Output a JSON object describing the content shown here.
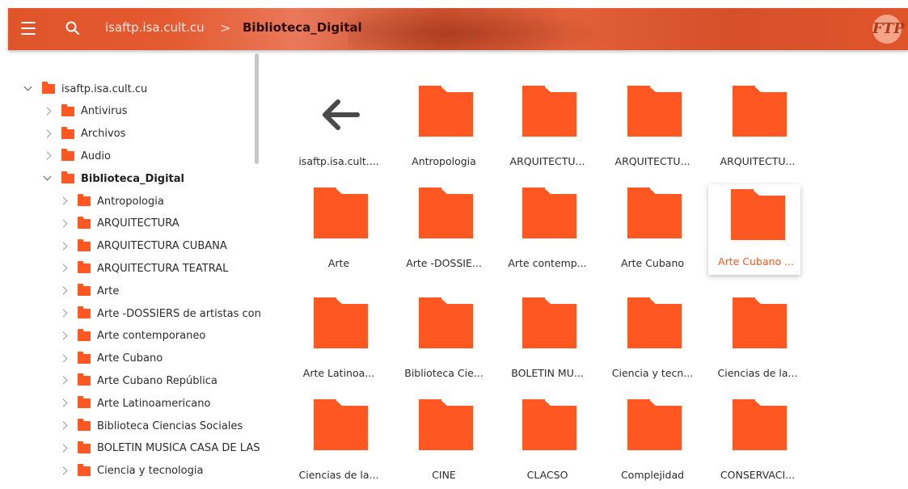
{
  "header": {
    "breadcrumb_root": "isaftp.isa.cult.cu",
    "breadcrumb_sep": ">",
    "breadcrumb_current": "Biblioteca_Digital",
    "logo_text": "FTP",
    "menu_icon": "hamburger-menu-icon",
    "search_icon": "search-icon",
    "accent_color": "#e0542a"
  },
  "tree": [
    {
      "label": "isaftp.isa.cult.cu",
      "expanded": true
    },
    {
      "label": "Antivirus"
    },
    {
      "label": "Archivos"
    },
    {
      "label": "Audio"
    },
    {
      "label": "Biblioteca_Digital",
      "expanded": true
    },
    {
      "label": "Antropologia"
    },
    {
      "label": "ARQUITECTURA"
    },
    {
      "label": "ARQUITECTURA CUBANA"
    },
    {
      "label": "ARQUITECTURA TEATRAL"
    },
    {
      "label": "Arte"
    },
    {
      "label": "Arte -DOSSIERS de artistas contei"
    },
    {
      "label": "Arte contemporaneo"
    },
    {
      "label": "Arte Cubano"
    },
    {
      "label": "Arte Cubano República"
    },
    {
      "label": "Arte Latinoamericano"
    },
    {
      "label": "Biblioteca Ciencias Sociales"
    },
    {
      "label": "BOLETIN MUSICA CASA DE LAS A"
    },
    {
      "label": "Ciencia y tecnologia"
    }
  ],
  "grid": [
    {
      "label": "isaftp.isa.cult....",
      "type": "back"
    },
    {
      "label": "Antropologia"
    },
    {
      "label": "ARQUITECTU..."
    },
    {
      "label": "ARQUITECTU..."
    },
    {
      "label": "ARQUITECTU..."
    },
    {
      "label": "Arte"
    },
    {
      "label": "Arte -DOSSIE..."
    },
    {
      "label": "Arte contemp..."
    },
    {
      "label": "Arte Cubano"
    },
    {
      "label": "Arte Cubano ...",
      "selected": true
    },
    {
      "label": "Arte Latinoa..."
    },
    {
      "label": "Biblioteca Cie..."
    },
    {
      "label": "BOLETIN MU..."
    },
    {
      "label": "Ciencia y tecn..."
    },
    {
      "label": "Ciencias de la..."
    },
    {
      "label": "Ciencias de la..."
    },
    {
      "label": "CINE"
    },
    {
      "label": "CLACSO"
    },
    {
      "label": "Complejidad"
    },
    {
      "label": "CONSERVACI..."
    }
  ],
  "colors": {
    "folder": "#ff5722",
    "selected_label": "#ff5722"
  }
}
